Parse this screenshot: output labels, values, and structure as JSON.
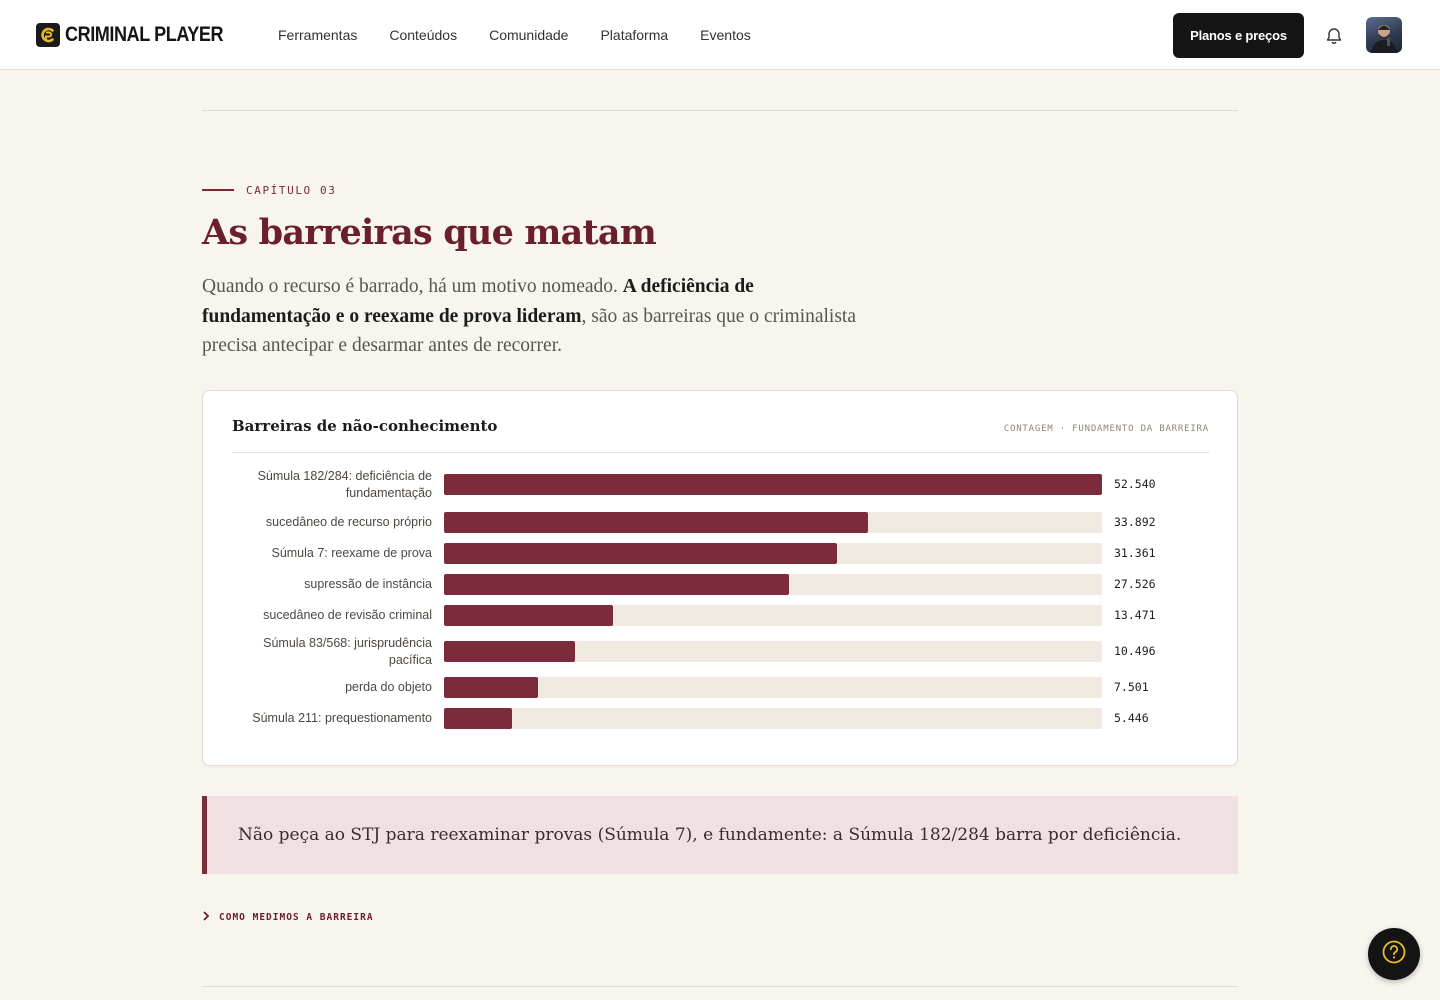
{
  "brand": {
    "name": "CRIMINAL PLAYER"
  },
  "nav": {
    "items": [
      "Ferramentas",
      "Conteúdos",
      "Comunidade",
      "Plataforma",
      "Eventos"
    ]
  },
  "header": {
    "cta_label": "Planos e preços"
  },
  "chapter": {
    "eyebrow": "CAPÍTULO 03",
    "title": "As barreiras que matam",
    "intro_lead": "Quando o recurso é barrado, há um motivo nomeado.",
    "intro_bold": "A deficiência de fundamentação e o reexame de prova lideram",
    "intro_tail": ", são as barreiras que o criminalista precisa antecipar e desarmar antes de recorrer."
  },
  "card": {
    "title": "Barreiras de não-conhecimento",
    "meta": "CONTAGEM · FUNDAMENTO DA BARREIRA"
  },
  "chart_data": {
    "type": "bar",
    "orientation": "horizontal",
    "title": "Barreiras de não-conhecimento",
    "categories": [
      "Súmula 182/284: deficiência de fundamentação",
      "sucedâneo de recurso próprio",
      "Súmula 7: reexame de prova",
      "supressão de instância",
      "sucedâneo de revisão criminal",
      "Súmula 83/568: jurisprudência pacífica",
      "perda do objeto",
      "Súmula 211: prequestionamento"
    ],
    "values": [
      52540,
      33892,
      31361,
      27526,
      13471,
      10496,
      7501,
      5446
    ],
    "value_labels": [
      "52.540",
      "33.892",
      "31.361",
      "27.526",
      "13.471",
      "10.496",
      "7.501",
      "5.446"
    ],
    "xlim": [
      0,
      52540
    ],
    "grid": false,
    "bar_color": "#7b2b39",
    "track_color": "#efe9df"
  },
  "callout": {
    "text": "Não peça ao STJ para reexaminar provas (Súmula 7), e fundamente: a Súmula 182/284 barra por deficiência."
  },
  "method": {
    "label": "COMO MEDIMOS A BARREIRA"
  },
  "colors": {
    "accent": "#7b2b39",
    "title": "#6b1e2c",
    "background": "#f8f4ee",
    "callout_bg": "#f1e0e3"
  }
}
